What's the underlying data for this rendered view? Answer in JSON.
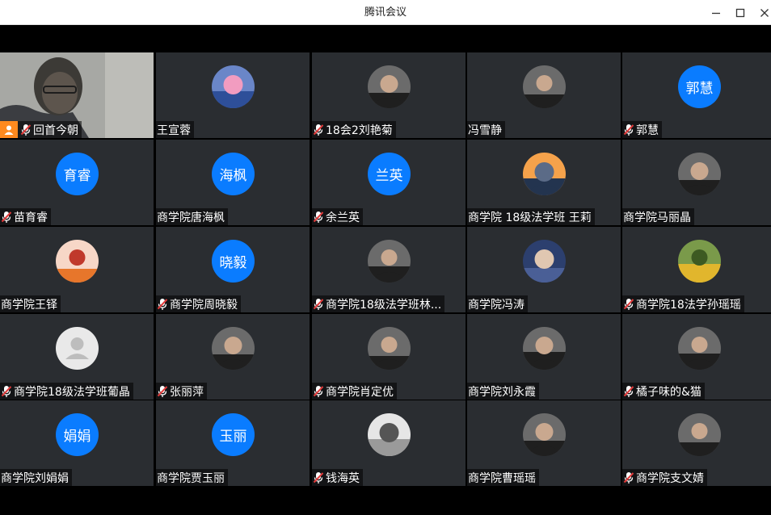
{
  "window": {
    "title": "腾讯会议",
    "minimize_icon": "minimize-icon",
    "maximize_icon": "maximize-icon",
    "close_icon": "close-icon"
  },
  "colors": {
    "tile_bg": "#2a2d31",
    "avatar_blue": "#0a7cff",
    "host_badge": "#ff8a1f",
    "muted_mic": "#e23b3b"
  },
  "participants": [
    {
      "name": "回首今朝",
      "muted": true,
      "host": true,
      "avatar_type": "video"
    },
    {
      "name": "王宣蓉",
      "muted": false,
      "avatar_type": "photo",
      "avatar_icon": "stitch-cartoon-icon"
    },
    {
      "name": "18会2刘艳菊",
      "muted": true,
      "avatar_type": "photo",
      "avatar_icon": "person-photo-icon"
    },
    {
      "name": "冯雪静",
      "muted": false,
      "avatar_type": "photo",
      "avatar_icon": "person-photo-icon"
    },
    {
      "name": "郭慧",
      "muted": true,
      "avatar_type": "text",
      "avatar_text": "郭慧"
    },
    {
      "name": "苗育睿",
      "muted": true,
      "avatar_type": "text",
      "avatar_text": "育睿"
    },
    {
      "name": "商学院唐海枫",
      "muted": false,
      "avatar_type": "text",
      "avatar_text": "海枫"
    },
    {
      "name": "余兰英",
      "muted": true,
      "avatar_type": "text",
      "avatar_text": "兰英"
    },
    {
      "name": "商学院 18级法学班 王莉",
      "muted": false,
      "avatar_type": "photo",
      "avatar_icon": "sunset-photo-icon"
    },
    {
      "name": "商学院马丽晶",
      "muted": false,
      "avatar_type": "photo",
      "avatar_icon": "person-photo-icon"
    },
    {
      "name": "商学院王铎",
      "muted": false,
      "avatar_type": "photo",
      "avatar_icon": "cartoon-tiger-icon"
    },
    {
      "name": "商学院周晓毅",
      "muted": true,
      "avatar_type": "text",
      "avatar_text": "晓毅"
    },
    {
      "name": "商学院18级法学班林...",
      "muted": true,
      "avatar_type": "photo",
      "avatar_icon": "person-photo-icon"
    },
    {
      "name": "商学院冯涛",
      "muted": false,
      "avatar_type": "photo",
      "avatar_icon": "hooded-cartoon-icon"
    },
    {
      "name": "商学院18法学孙瑶瑶",
      "muted": true,
      "avatar_type": "photo",
      "avatar_icon": "cartoon-bear-icon"
    },
    {
      "name": "商学院18级法学班葡晶",
      "muted": true,
      "avatar_type": "default",
      "avatar_icon": "default-user-icon"
    },
    {
      "name": "张丽萍",
      "muted": true,
      "avatar_type": "photo",
      "avatar_icon": "person-photo-icon"
    },
    {
      "name": "商学院肖定优",
      "muted": true,
      "avatar_type": "photo",
      "avatar_icon": "person-photo-icon"
    },
    {
      "name": "商学院刘永霞",
      "muted": false,
      "avatar_type": "photo",
      "avatar_icon": "person-photo-icon"
    },
    {
      "name": "橘子味的&猫",
      "muted": true,
      "avatar_type": "photo",
      "avatar_icon": "person-photo-icon"
    },
    {
      "name": "商学院刘娟娟",
      "muted": false,
      "avatar_type": "text",
      "avatar_text": "娟娟"
    },
    {
      "name": "商学院贾玉丽",
      "muted": false,
      "avatar_type": "text",
      "avatar_text": "玉丽"
    },
    {
      "name": "钱海英",
      "muted": true,
      "avatar_type": "photo",
      "avatar_icon": "cartoon-cat-icon"
    },
    {
      "name": "商学院曹瑶瑶",
      "muted": false,
      "avatar_type": "photo",
      "avatar_icon": "person-photo-icon"
    },
    {
      "name": "商学院支文婧",
      "muted": true,
      "avatar_type": "photo",
      "avatar_icon": "person-photo-icon"
    }
  ]
}
